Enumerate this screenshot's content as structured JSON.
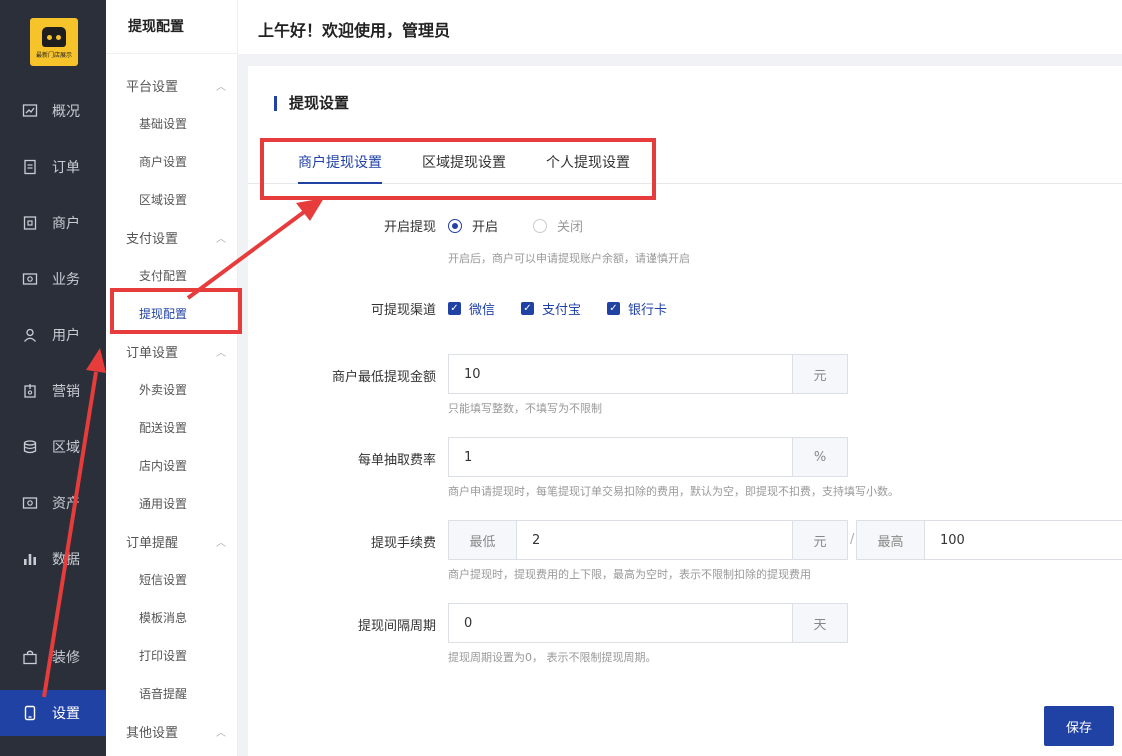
{
  "logo": {
    "text": "最新门店展示"
  },
  "nav": {
    "items": [
      {
        "label": "概况",
        "icon": "chart-icon"
      },
      {
        "label": "订单",
        "icon": "document-icon"
      },
      {
        "label": "商户",
        "icon": "store-icon"
      },
      {
        "label": "业务",
        "icon": "briefcase-icon"
      },
      {
        "label": "用户",
        "icon": "user-icon"
      },
      {
        "label": "营销",
        "icon": "marketing-icon"
      },
      {
        "label": "区域",
        "icon": "database-icon"
      },
      {
        "label": "资产",
        "icon": "asset-icon"
      },
      {
        "label": "数据",
        "icon": "bar-chart-icon"
      },
      {
        "label": "装修",
        "icon": "bag-icon"
      },
      {
        "label": "设置",
        "icon": "tablet-icon"
      }
    ],
    "active": "设置"
  },
  "subnav": {
    "title": "提现配置",
    "groups": [
      {
        "label": "平台设置",
        "items": [
          "基础设置",
          "商户设置",
          "区域设置"
        ]
      },
      {
        "label": "支付设置",
        "items": [
          "支付配置",
          "提现配置"
        ]
      },
      {
        "label": "订单设置",
        "items": [
          "外卖设置",
          "配送设置",
          "店内设置",
          "通用设置"
        ]
      },
      {
        "label": "订单提醒",
        "items": [
          "短信设置",
          "模板消息",
          "打印设置",
          "语音提醒"
        ]
      },
      {
        "label": "其他设置",
        "items": []
      }
    ],
    "active": "提现配置"
  },
  "header": {
    "greeting": "上午好！欢迎使用，管理员"
  },
  "section": {
    "title": "提现设置"
  },
  "tabs": [
    {
      "label": "商户提现设置",
      "active": true
    },
    {
      "label": "区域提现设置",
      "active": false
    },
    {
      "label": "个人提现设置",
      "active": false
    }
  ],
  "form": {
    "enable": {
      "label": "开启提现",
      "options": [
        "开启",
        "关闭"
      ],
      "selected": "开启",
      "hint": "开启后，商户可以申请提现账户余额，请谨慎开启"
    },
    "channels": {
      "label": "可提现渠道",
      "options": [
        {
          "label": "微信",
          "checked": true
        },
        {
          "label": "支付宝",
          "checked": true
        },
        {
          "label": "银行卡",
          "checked": true
        }
      ]
    },
    "min_amount": {
      "label": "商户最低提现金额",
      "value": "10",
      "suffix": "元",
      "hint": "只能填写整数，不填写为不限制"
    },
    "fee_rate": {
      "label": "每单抽取费率",
      "value": "1",
      "suffix": "%",
      "hint": "商户申请提现时，每笔提现订单交易扣除的费用，默认为空，即提现不扣费，支持填写小数。"
    },
    "fee": {
      "label": "提现手续费",
      "min_prefix": "最低",
      "min_value": "2",
      "min_suffix": "元",
      "separator": "/",
      "max_prefix": "最高",
      "max_value": "100",
      "hint": "商户提现时，提现费用的上下限，最高为空时，表示不限制扣除的提现费用"
    },
    "interval": {
      "label": "提现间隔周期",
      "value": "0",
      "suffix": "天",
      "hint": "提现周期设置为0， 表示不限制提现周期。"
    }
  },
  "buttons": {
    "save": "保存"
  },
  "colors": {
    "primary": "#2142a5",
    "nav_bg": "#2b2f3a",
    "annotation": "#e63c3c"
  }
}
